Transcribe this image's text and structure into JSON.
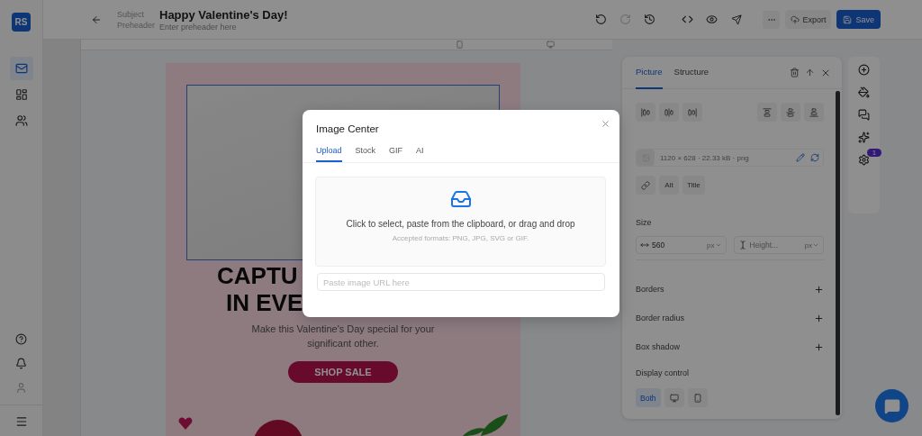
{
  "sidebar": {
    "logo": "RS",
    "nav": [
      {
        "selected": true
      },
      {
        "selected": false
      },
      {
        "selected": false
      }
    ]
  },
  "header": {
    "subject": {
      "label": "Subject",
      "value": "Happy Valentine's Day!"
    },
    "preheader": {
      "label": "Preheader",
      "placeholder": "Enter preheader here"
    },
    "redo": {
      "disabled": true
    },
    "export": "Export",
    "save": "Save"
  },
  "email": {
    "headline": [
      "CAPTU",
      "IN EVE"
    ],
    "text": "Make this Valentine's Day special for your significant other.",
    "button": "SHOP SALE"
  },
  "panel": {
    "tabs": [
      {
        "label": "Picture",
        "selected": true
      },
      {
        "label": "Structure",
        "selected": false
      }
    ],
    "image_info": "1120 × 628 · 22.33 kB · png",
    "attributes": [
      "Alt",
      "Title"
    ],
    "size": {
      "label": "Size",
      "width": {
        "value": "560",
        "unit": "px"
      },
      "height": {
        "placeholder": "Height...",
        "unit": "px"
      }
    },
    "sections": [
      "Borders",
      "Border radius",
      "Box shadow"
    ],
    "display_control": {
      "label": "Display control",
      "options": [
        {
          "kind": "text",
          "label": "Both",
          "selected": true
        },
        {
          "kind": "desktop",
          "selected": false
        },
        {
          "kind": "mobile",
          "selected": false
        }
      ]
    }
  },
  "tools": {
    "badge": "1"
  },
  "modal": {
    "title": "Image Center",
    "tabs": [
      {
        "label": "Upload",
        "selected": true
      },
      {
        "label": "Stock",
        "selected": false
      },
      {
        "label": "GIF",
        "selected": false
      },
      {
        "label": "AI",
        "selected": false
      }
    ],
    "dropzone": {
      "text": "Click to select, paste from the clipboard, or drag and drop",
      "hint": "Accepted formats: PNG, JPG, SVG or GIF."
    },
    "url": {
      "placeholder": "Paste image URL here"
    }
  }
}
